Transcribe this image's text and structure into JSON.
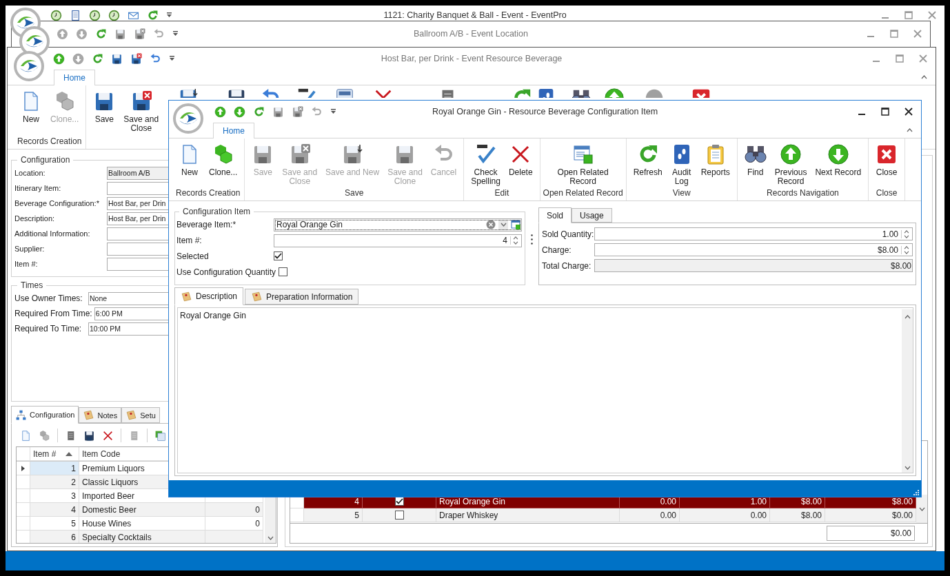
{
  "main_window": {
    "title": "1121: Charity Banquet & Ball - Event - EventPro"
  },
  "location_window": {
    "title": "Ballroom A/B - Event Location"
  },
  "resource_window": {
    "title": "Host Bar, per Drink - Event Resource Beverage",
    "tabs": [
      {
        "label": "Home",
        "selected": true
      }
    ],
    "ribbon_groups": [
      {
        "label": "Records Creation",
        "buttons": [
          {
            "label": "New",
            "kind": "new",
            "disabled": false
          },
          {
            "label": "Clone...",
            "kind": "clone",
            "disabled": true
          }
        ]
      },
      {
        "buttons": [
          {
            "label": "Save",
            "kind": "save",
            "disabled": false
          },
          {
            "label": "Save and\nClose",
            "kind": "save-close",
            "disabled": false
          }
        ]
      }
    ],
    "configuration": {
      "title": "Configuration",
      "fields": [
        {
          "label": "Location:",
          "value": "Ballroom A/B",
          "readonly": true
        },
        {
          "label": "Itinerary Item:",
          "readonly": false
        },
        {
          "label": "Beverage Configuration:*",
          "value": "Host Bar, per Drin",
          "readonly": false
        },
        {
          "label": "Description:",
          "value": "Host Bar, per Drin",
          "readonly": false
        },
        {
          "label": "Additional Information:",
          "readonly": false
        },
        {
          "label": "Supplier:",
          "readonly": false
        },
        {
          "label": "Item #:",
          "readonly": false
        }
      ]
    },
    "times": {
      "title": "Times",
      "fields": [
        {
          "label": "Use Owner Times:",
          "value": "None"
        },
        {
          "label": "Required From Time:",
          "value": "6:00 PM"
        },
        {
          "label": "Required To Time:",
          "value": "10:00 PM"
        }
      ]
    },
    "detail_tabs": [
      {
        "label": "Configuration",
        "selected": true,
        "kind": "tree"
      },
      {
        "label": "Notes",
        "selected": false,
        "kind": "note"
      },
      {
        "label": "Setu",
        "selected": false,
        "kind": "note"
      }
    ],
    "items_table": {
      "columns": [
        "Item #",
        "Item Code"
      ],
      "rows": [
        {
          "item": "1",
          "code": "Premium Liquors",
          "selected": true
        },
        {
          "item": "2",
          "code": "Classic Liquors",
          "selected": false
        },
        {
          "item": "3",
          "code": "Imported Beer",
          "selected": false
        },
        {
          "item": "4",
          "code": "Domestic Beer",
          "column_3": "0",
          "selected": false
        },
        {
          "item": "5",
          "code": "House Wines",
          "column_3": "0",
          "selected": false
        },
        {
          "item": "6",
          "code": "Specialty Cocktails",
          "selected": false
        }
      ]
    },
    "beverage_table": {
      "rows": [
        {
          "cells": [
            "4",
            "Royal Orange Gin",
            "0.00",
            "1.00",
            "$8.00",
            "$8.00"
          ],
          "checked": true,
          "selected": true
        },
        {
          "cells": [
            "5",
            "Draper Whiskey",
            "0.00",
            "0.00",
            "$8.00",
            "$0.00"
          ],
          "checked": false,
          "selected": false
        }
      ],
      "total": "$0.00"
    }
  },
  "dialog": {
    "title": "Royal Orange Gin - Resource Beverage Configuration Item",
    "tabs": [
      {
        "label": "Home",
        "selected": true
      }
    ],
    "ribbon_groups": [
      {
        "label": "Records Creation",
        "buttons": [
          {
            "label": "New",
            "kind": "new",
            "disabled": false
          },
          {
            "label": "Clone...",
            "kind": "clone",
            "disabled": false
          }
        ]
      },
      {
        "label": "Save",
        "buttons": [
          {
            "label": "Save",
            "kind": "save",
            "disabled": true
          },
          {
            "label": "Save and\nClose",
            "kind": "save-close",
            "disabled": true
          },
          {
            "label": "Save and New",
            "kind": "save-new",
            "disabled": true
          },
          {
            "label": "Save and\nClone",
            "kind": "save-clone",
            "disabled": true
          },
          {
            "label": "Cancel",
            "kind": "undo",
            "disabled": true
          }
        ]
      },
      {
        "label": "Edit",
        "buttons": [
          {
            "label": "Check\nSpelling",
            "kind": "spell",
            "disabled": false
          },
          {
            "label": "Delete",
            "kind": "delete",
            "disabled": false
          }
        ]
      },
      {
        "label": "Open Related Record",
        "buttons": [
          {
            "label": "Open Related\nRecord",
            "kind": "related",
            "disabled": false
          }
        ]
      },
      {
        "label": "View",
        "buttons": [
          {
            "label": "Refresh",
            "kind": "refresh",
            "disabled": false
          },
          {
            "label": "Audit\nLog",
            "kind": "audit",
            "disabled": false
          },
          {
            "label": "Reports",
            "kind": "reports",
            "disabled": false
          }
        ]
      },
      {
        "label": "Records Navigation",
        "buttons": [
          {
            "label": "Find",
            "kind": "find",
            "disabled": false
          },
          {
            "label": "Previous\nRecord",
            "kind": "up",
            "disabled": false
          },
          {
            "label": "Next Record",
            "kind": "down",
            "disabled": false
          }
        ]
      },
      {
        "label": "Close",
        "buttons": [
          {
            "label": "Close",
            "kind": "close",
            "disabled": false
          }
        ]
      }
    ],
    "item": {
      "title": "Configuration Item",
      "beverage_label": "Beverage Item:*",
      "beverage_value": "Royal Orange Gin",
      "number_label": "Item #:",
      "number_value": "4",
      "checks": [
        {
          "label": "Selected",
          "checked": true
        },
        {
          "label": "Use Configuration Quantity",
          "checked": false
        }
      ]
    },
    "price_tabs": [
      {
        "label": "Sold",
        "selected": true
      },
      {
        "label": "Usage",
        "selected": false
      }
    ],
    "price_fields": [
      {
        "label": "Sold Quantity:",
        "value": "1.00",
        "kind": "spin"
      },
      {
        "label": "Charge:",
        "value": "$8.00",
        "kind": "spin"
      },
      {
        "label": "Total Charge:",
        "value": "$8.00",
        "kind": "readonly"
      }
    ],
    "text_tabs": [
      {
        "label": "Description",
        "selected": true
      },
      {
        "label": "Preparation Information",
        "selected": false
      }
    ],
    "description": "Royal Orange Gin"
  }
}
